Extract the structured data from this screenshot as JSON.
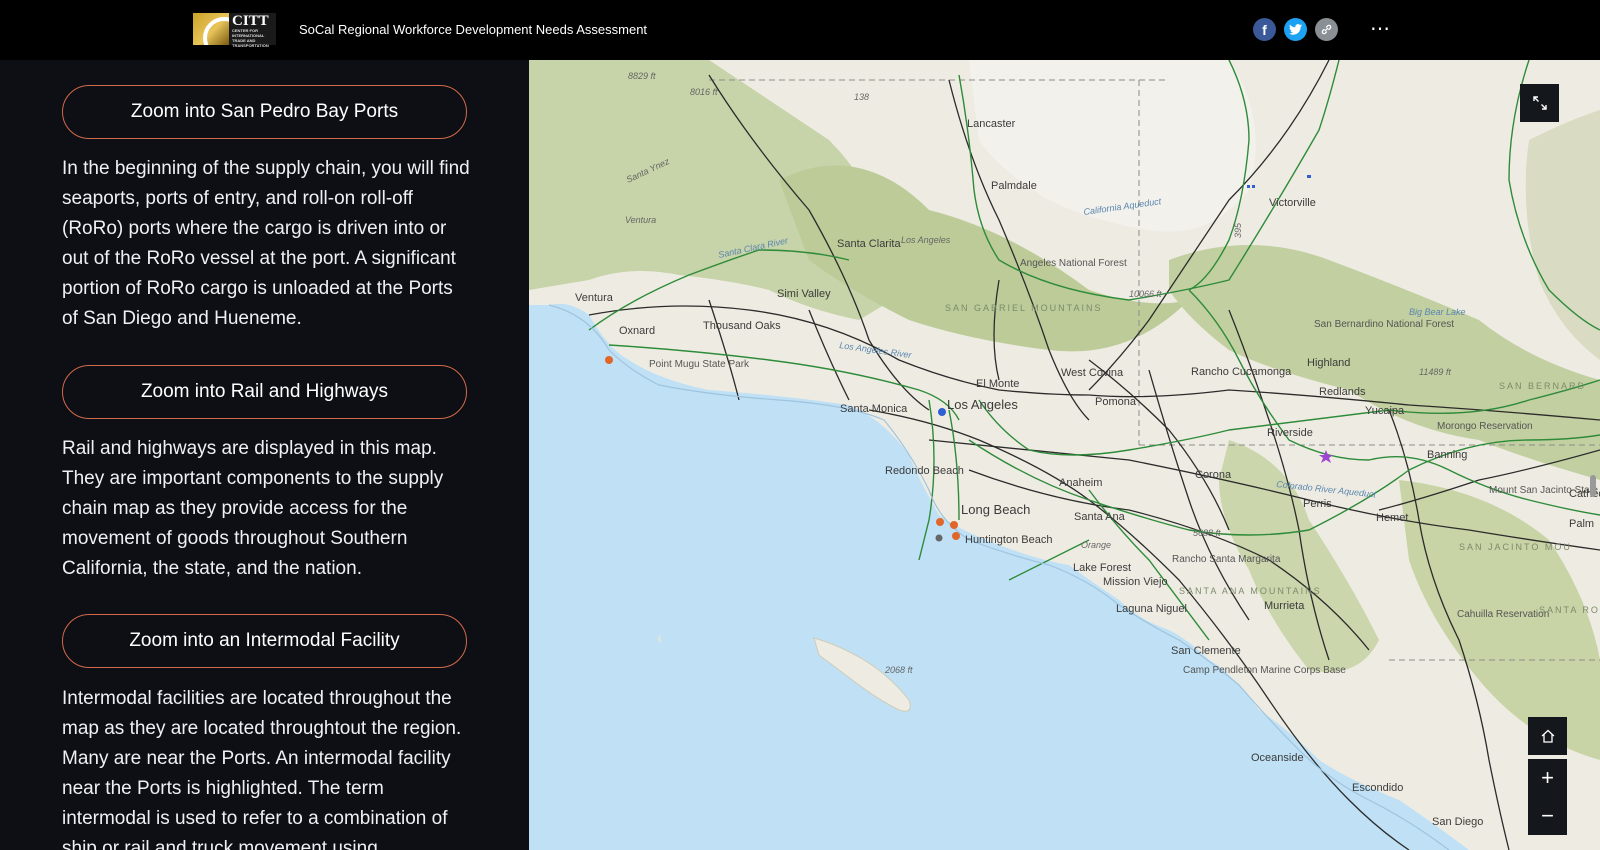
{
  "header": {
    "logo_text": "CITT",
    "logo_subtext": "CENTER FOR INTERNATIONAL TRADE AND TRANSPORTATION",
    "title": "SoCal Regional Workforce Development Needs Assessment",
    "share_icons": [
      "facebook-icon",
      "twitter-icon",
      "link-icon"
    ],
    "more_label": "⋯"
  },
  "sidebar": {
    "sections": [
      {
        "button_label": "Zoom into San Pedro Bay Ports",
        "text": "In the beginning of the supply chain, you will find seaports, ports of entry, and roll-on roll-off (RoRo) ports where the cargo is driven into or out of the RoRo vessel at the port. A significant portion of RoRo cargo is unloaded at the Ports of San Diego and Hueneme."
      },
      {
        "button_label": "Zoom into Rail and Highways",
        "text": "Rail and highways are displayed in this map. They are important components to the supply chain map as they provide access for the movement of goods throughout Southern California, the state, and the nation."
      },
      {
        "button_label": "Zoom into an Intermodal Facility",
        "text": "Intermodal facilities are located throughout the map as they are located throughtout the region. Many are near the Ports. An intermodal facility near the Ports is highlighted. The term intermodal is used to refer to a combination of ship or rail and truck movement using"
      }
    ]
  },
  "map": {
    "colors": {
      "water": "#bfe0f5",
      "land": "#eeece2",
      "vegetation": "#c7d3a8",
      "rail": "#2e8b3a",
      "highway": "#2b2b2b",
      "accent": "#d4694a"
    },
    "place_labels": [
      "Lancaster",
      "Palmdale",
      "Victorville",
      "Santa Clarita",
      "Ventura",
      "Simi Valley",
      "Oxnard",
      "Thousand Oaks",
      "Santa Monica",
      "Los Angeles",
      "El Monte",
      "West Covina",
      "Pomona",
      "Rancho Cucamonga",
      "Highland",
      "Redlands",
      "Yucaipa",
      "Riverside",
      "Banning",
      "Redondo Beach",
      "Anaheim",
      "Corona",
      "Perris",
      "Hemet",
      "Long Beach",
      "Santa Ana",
      "Huntington Beach",
      "Lake Forest",
      "Mission Viejo",
      "Rancho Santa Margarita",
      "Laguna Niguel",
      "Murrieta",
      "San Clemente",
      "Camp Pendleton Marine Corps Base",
      "Oceanside",
      "Escondido",
      "San Diego",
      "Point Mugu State Park",
      "San Bernardino National Forest",
      "Angeles National Forest",
      "Morongo Reservation",
      "Mount San Jacinto State Park",
      "Cahuilla Reservation",
      "Cathedral City",
      "Palm",
      "SAN GABRIEL MOUNTAINS",
      "SANTA ANA MOUNTAINS",
      "SAN JACINTO MOU",
      "SAN BERNARD",
      "SANTA ROS",
      "Big Bear Lake",
      "Los Angeles",
      "California Aqueduct",
      "Santa Clara River",
      "Los Angeles River",
      "Colorado River Aqueduct",
      "Santa Ynez",
      "Ventura",
      "Orange"
    ],
    "elevation_labels": [
      "8829 ft",
      "8016 ft",
      "10066 ft",
      "11489 ft",
      "5688 ft",
      "2068 ft"
    ],
    "route_numbers": [
      "138",
      "395"
    ],
    "controls": {
      "expand_icon": "expand-icon",
      "home_icon": "home-icon",
      "zoom_in_label": "+",
      "zoom_out_label": "−"
    }
  }
}
